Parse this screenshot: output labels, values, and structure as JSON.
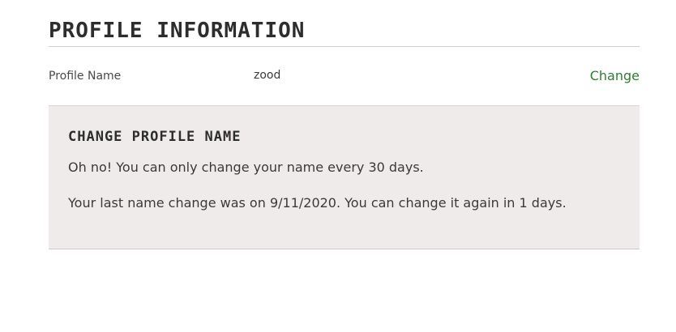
{
  "header": {
    "title": "PROFILE INFORMATION"
  },
  "profile": {
    "label": "Profile Name",
    "value": "zood",
    "change_link": "Change"
  },
  "panel": {
    "title": "CHANGE PROFILE NAME",
    "message": "Oh no! You can only change your name every 30 days.",
    "detail": "Your last name change was on 9/11/2020. You can change it again in 1 days."
  },
  "colors": {
    "accent": "#2f7d32",
    "panel_background": "#efebea",
    "heading": "#2d2d2d"
  }
}
